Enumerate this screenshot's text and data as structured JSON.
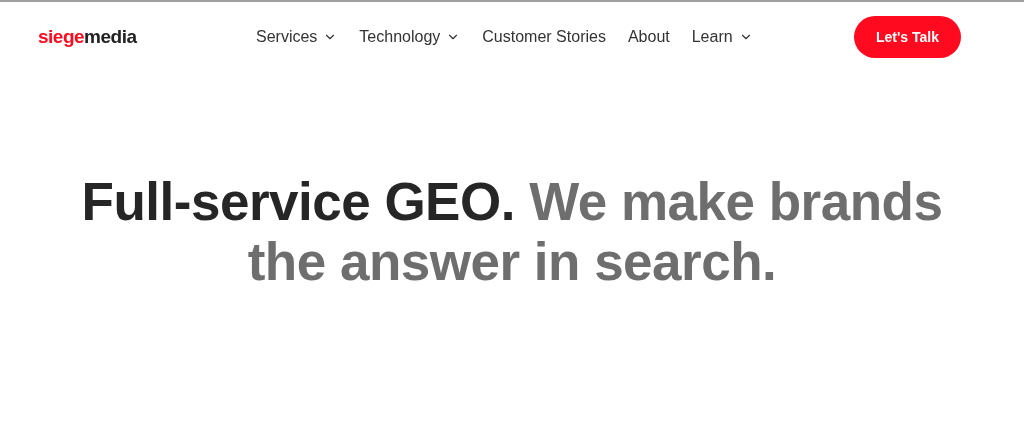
{
  "header": {
    "logo": {
      "accent": "siege",
      "rest": "media"
    },
    "nav": [
      {
        "label": "Services",
        "dropdown": true
      },
      {
        "label": "Technology",
        "dropdown": true
      },
      {
        "label": "Customer Stories",
        "dropdown": false
      },
      {
        "label": "About",
        "dropdown": false
      },
      {
        "label": "Learn",
        "dropdown": true
      }
    ],
    "cta": "Let's Talk"
  },
  "hero": {
    "headline_lead": "Full-service GEO.",
    "headline_rest": "We make brands the answer in search."
  }
}
